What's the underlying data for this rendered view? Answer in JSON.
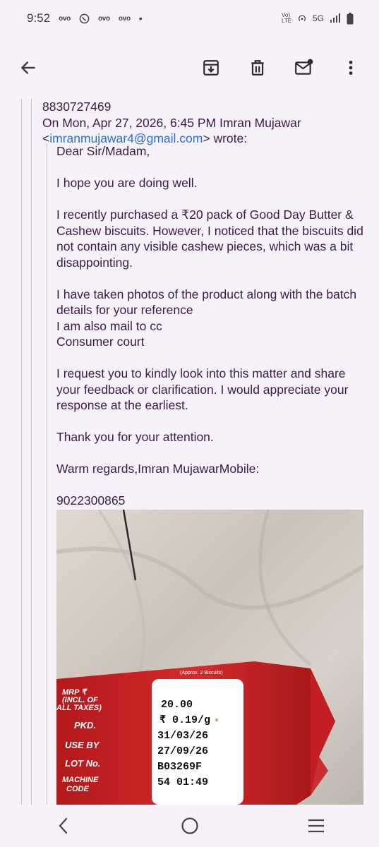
{
  "status_bar": {
    "time": "9:52",
    "left_icons": [
      "ovo",
      "ovo",
      "ovo"
    ],
    "network": "5G",
    "volte_label": "Vo) LTE"
  },
  "toolbar": {
    "back_icon": "arrow-back-icon",
    "archive_icon": "archive-icon",
    "delete_icon": "trash-icon",
    "mark_unread_icon": "mail-unread-icon",
    "more_icon": "more-vert-icon"
  },
  "email": {
    "top_number": "8830727469",
    "quote_header_line1": "On Mon, Apr 27, 2026, 6:45 PM Imran Mujawar",
    "quote_header_lt": "<",
    "quote_email": "imranmujawar4@gmail.com",
    "quote_header_end": "> wrote:",
    "body_lines": [
      "Dear Sir/Madam,",
      "I hope you are doing well.",
      "I recently purchased a ₹20 pack of Good Day Butter & Cashew biscuits. However, I noticed that the biscuits did not contain any visible cashew pieces, which was a bit disappointing.",
      "I have taken photos of the product along with the batch details for your reference",
      "I am also mail to cc",
      "Consumer court",
      "I request you to kindly look into this matter and share your feedback or clarification. I would appreciate your response at the earliest.",
      "Thank you for your attention.",
      "Warm regards,Imran MujawarMobile:",
      "9022300865"
    ]
  },
  "photo": {
    "pack_labels": [
      "MRP ₹",
      "(INCL. OF",
      "ALL TAXES)",
      "PKD.",
      "USE BY",
      "LOT No.",
      "MACHINE",
      "CODE"
    ],
    "pack_values": [
      "20.00",
      "₹ 0.19/g",
      "31/03/26",
      "27/09/26",
      "B03269F",
      "54  01:49"
    ],
    "top_strip": "(Approx. 2 Biscuits)"
  },
  "nav": {
    "back_icon": "nav-back-icon",
    "home_icon": "nav-home-icon",
    "recents_icon": "nav-recents-icon"
  },
  "colors": {
    "background": "#f7f2fa",
    "text": "#3b1a4a",
    "link": "#2a6fd1"
  }
}
